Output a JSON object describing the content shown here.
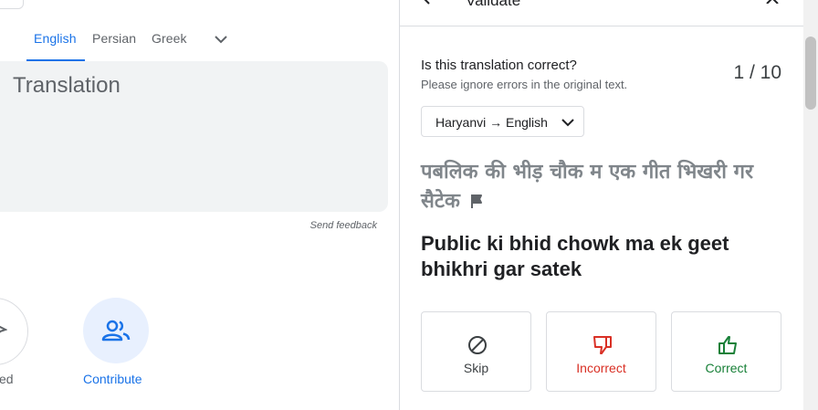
{
  "languages": {
    "items": [
      "English",
      "Persian",
      "Greek"
    ],
    "active": "English"
  },
  "translation": {
    "placeholder": "Translation",
    "feedback": "Send feedback"
  },
  "actions": {
    "left_label_partial": "ed",
    "contribute_label": "Contribute"
  },
  "validate": {
    "title": "Validate",
    "question": "Is this translation correct?",
    "subtitle": "Please ignore errors in the original text.",
    "counter": "1 / 10",
    "language_pair": "Haryanvi → English",
    "source_text": "पबलिक की भीड़ चौक म एक गीत भिखरी गर सैटेक",
    "romanized_text": "Public ki bhid chowk ma ek geet bhikhri gar satek",
    "buttons": {
      "skip": "Skip",
      "incorrect": "Incorrect",
      "correct": "Correct"
    }
  },
  "colors": {
    "accent": "#1a73e8",
    "incorrect": "#d93025",
    "correct": "#188038",
    "muted": "#5f6368"
  },
  "icons": [
    "chevron-down-icon",
    "contribute-icon",
    "back-arrow-icon",
    "close-icon",
    "flag-icon",
    "skip-icon",
    "thumbs-down-icon",
    "thumbs-up-icon"
  ]
}
